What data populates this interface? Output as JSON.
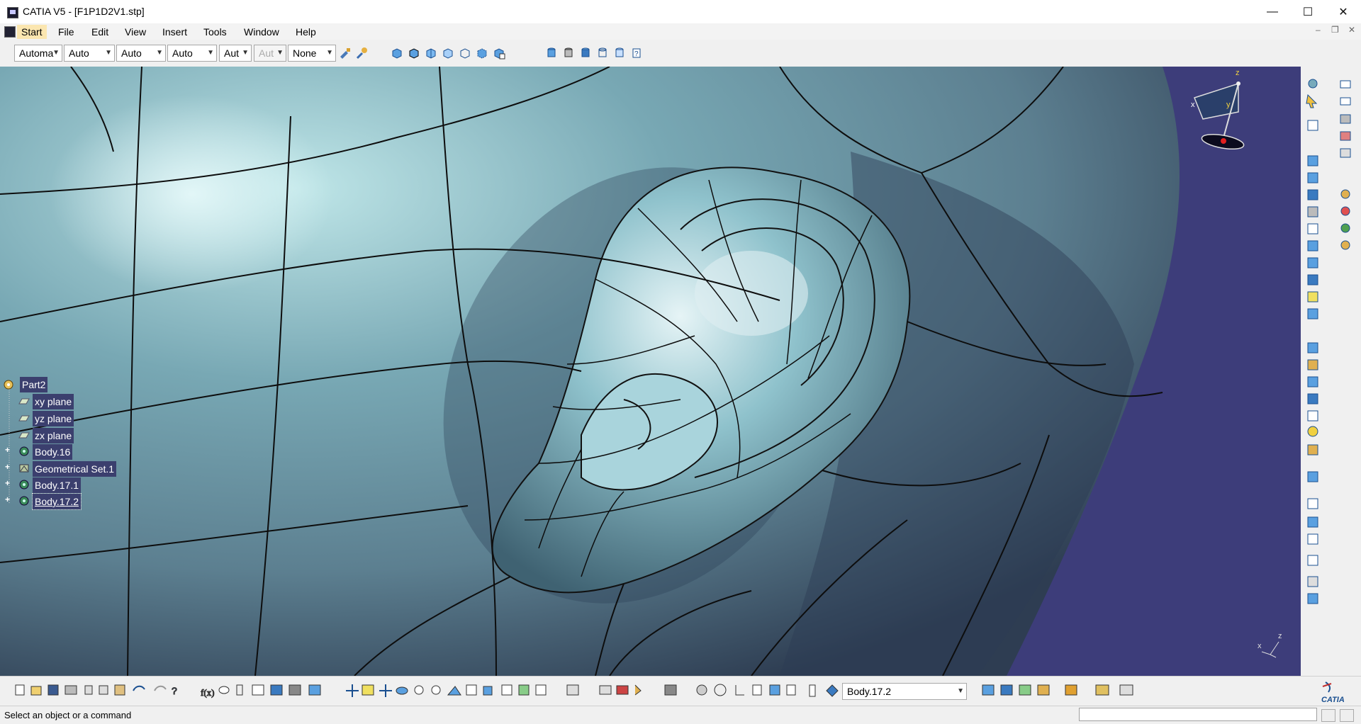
{
  "window": {
    "title": "CATIA V5 - [F1P1D2V1.stp]",
    "controls": {
      "minimize": "—",
      "maximize": "☐",
      "close": "✕"
    },
    "doc_controls": {
      "minimize": "–",
      "restore": "❐",
      "close": "✕"
    }
  },
  "menu": [
    {
      "label": "Start"
    },
    {
      "label": "File"
    },
    {
      "label": "Edit"
    },
    {
      "label": "View"
    },
    {
      "label": "Insert"
    },
    {
      "label": "Tools"
    },
    {
      "label": "Window"
    },
    {
      "label": "Help"
    }
  ],
  "graphic_props": {
    "color": "Automa",
    "transparency": "Auto",
    "line_thickness": "Auto",
    "line_type": "Auto",
    "point_type": "Aut",
    "rendering": "Aut",
    "layer": "None"
  },
  "tree": {
    "root": "Part2",
    "nodes": [
      {
        "label": "xy plane",
        "icon": "plane-icon",
        "expandable": false
      },
      {
        "label": "yz plane",
        "icon": "plane-icon",
        "expandable": false
      },
      {
        "label": "zx plane",
        "icon": "plane-icon",
        "expandable": false
      },
      {
        "label": "Body.16",
        "icon": "body-icon",
        "expandable": true
      },
      {
        "label": "Geometrical Set.1",
        "icon": "geometrical-set-icon",
        "expandable": true
      },
      {
        "label": "Body.17.1",
        "icon": "body-icon",
        "expandable": true
      },
      {
        "label": "Body.17.2",
        "icon": "body-icon",
        "expandable": true
      }
    ]
  },
  "compass": {
    "x": "x",
    "y": "y",
    "z": "z"
  },
  "axis_triad": {
    "x": "x",
    "y": "y",
    "z": "z"
  },
  "current_body": "Body.17.2",
  "status": "Select an object or a command",
  "brand": "CATIA",
  "colors": {
    "background": "#3d3d7a",
    "surface": "#5f8c96",
    "tree_highlight": "#3b3f6e",
    "start_menu": "#fbe6b0"
  }
}
